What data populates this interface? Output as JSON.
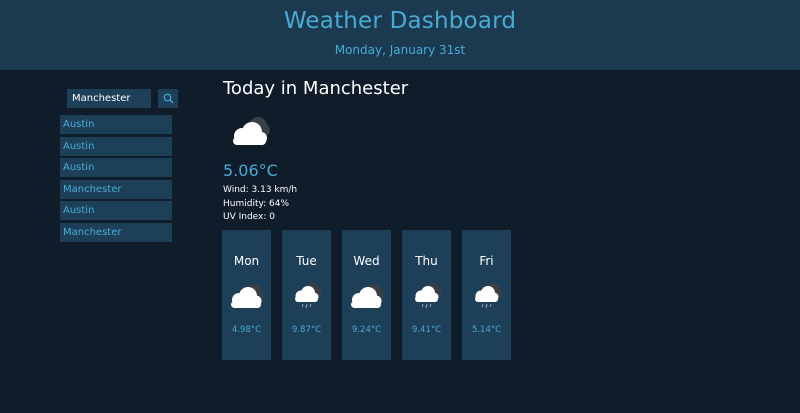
{
  "header": {
    "title": "Weather Dashboard",
    "date": "Monday, January 31st"
  },
  "search": {
    "value": "Manchester",
    "button_icon": "search-icon"
  },
  "history": [
    "Austin",
    "Austin",
    "Austin",
    "Manchester",
    "Austin",
    "Manchester"
  ],
  "today": {
    "title": "Today in Manchester",
    "icon": "cloudy-icon",
    "temp": "5.06°C",
    "wind": "Wind: 3.13 km/h",
    "humidity": "Humidity: 64%",
    "uv": "UV Index: 0"
  },
  "forecast": [
    {
      "day": "Mon",
      "icon": "cloudy-icon",
      "temp": "4.98°C"
    },
    {
      "day": "Tue",
      "icon": "rain-icon",
      "temp": "9.87°C"
    },
    {
      "day": "Wed",
      "icon": "cloudy-icon",
      "temp": "9.24°C"
    },
    {
      "day": "Thu",
      "icon": "rain-icon",
      "temp": "9.41°C"
    },
    {
      "day": "Fri",
      "icon": "rain-icon",
      "temp": "5.14°C"
    }
  ],
  "colors": {
    "background": "#0f1d2b",
    "header": "#1b3a50",
    "card": "#1d3f58",
    "accent": "#4aaad6",
    "text": "#ffffff"
  }
}
